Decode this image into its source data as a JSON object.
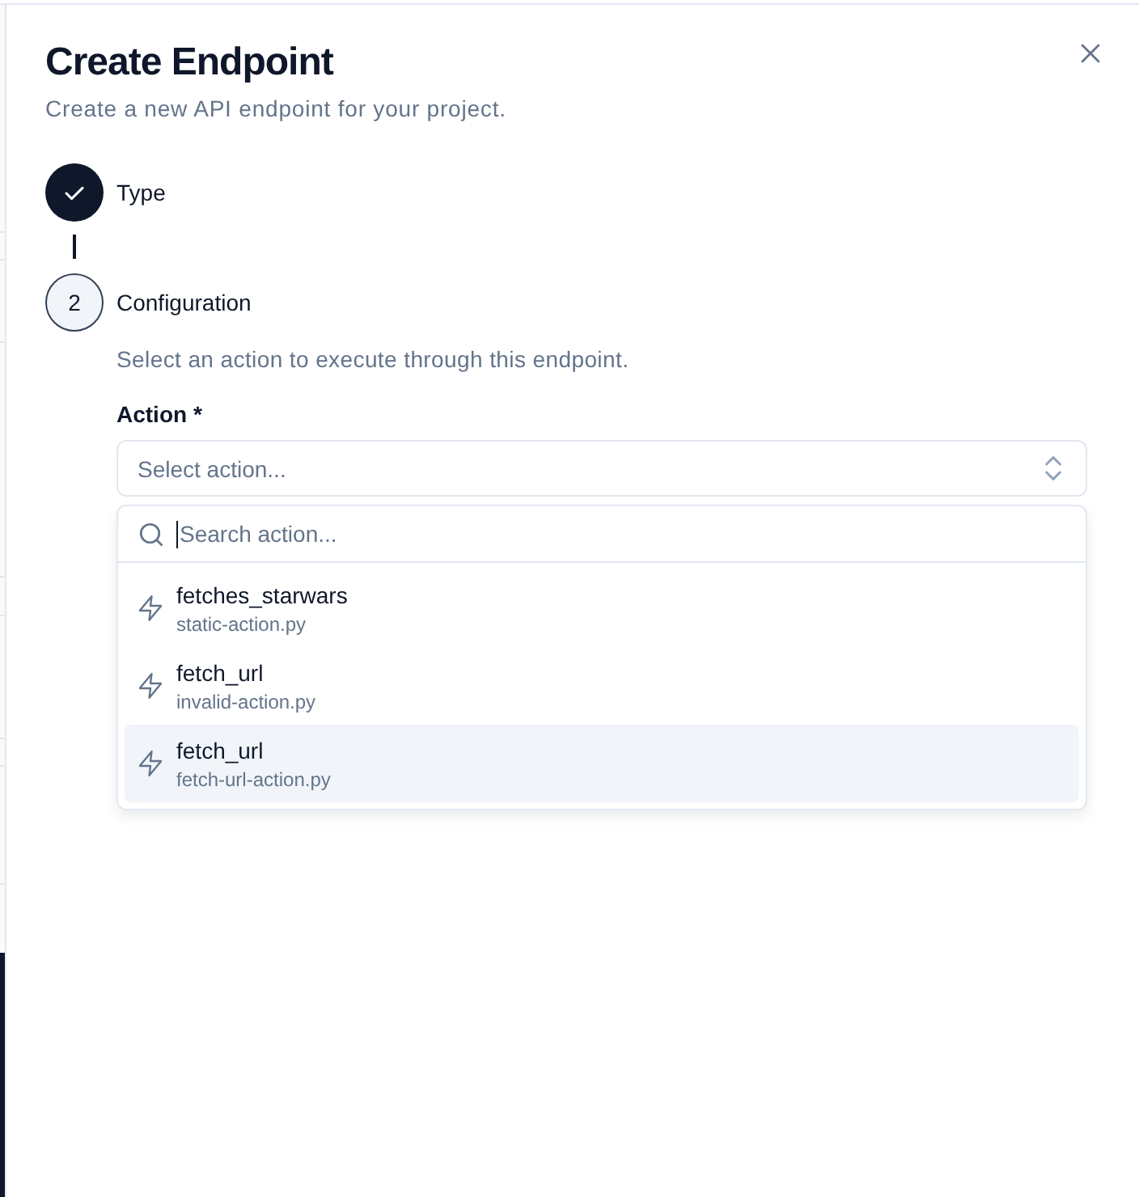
{
  "dialog": {
    "title": "Create Endpoint",
    "subtitle": "Create a new API endpoint for your project."
  },
  "steps": [
    {
      "label": "Type",
      "completed": true
    },
    {
      "number": "2",
      "label": "Configuration",
      "completed": false,
      "description": "Select an action to execute through this endpoint.",
      "field": {
        "label": "Action *",
        "placeholder": "Select action...",
        "expanded": true
      }
    }
  ],
  "dropdown": {
    "search": {
      "placeholder": "Search action...",
      "focused": true
    },
    "options": [
      {
        "name": "fetches_starwars",
        "file": "static-action.py",
        "selected": false
      },
      {
        "name": "fetch_url",
        "file": "invalid-action.py",
        "selected": false
      },
      {
        "name": "fetch_url",
        "file": "fetch-url-action.py",
        "selected": true
      }
    ]
  }
}
